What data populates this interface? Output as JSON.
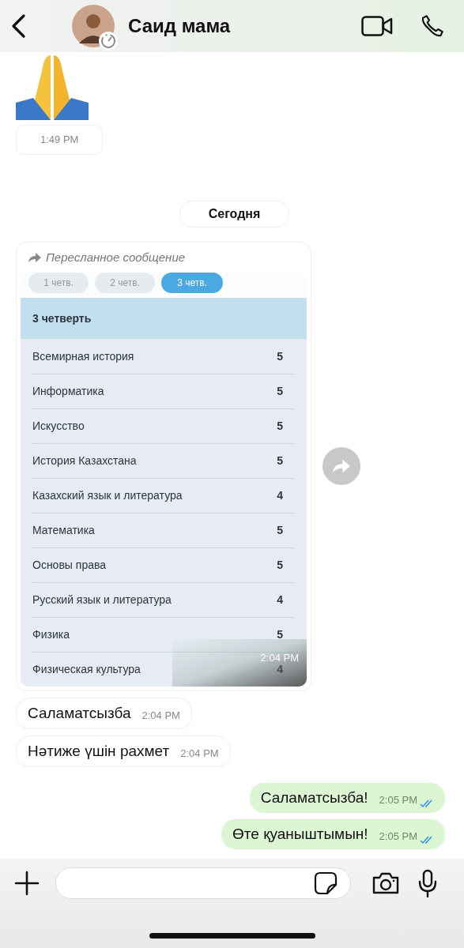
{
  "header": {
    "title": "Саид мама"
  },
  "messages": [
    {
      "kind": "sticker",
      "time": "1:49 PM"
    },
    {
      "kind": "date",
      "text": "Сегодня"
    },
    {
      "kind": "forwarded",
      "forward_label": "Пересланное сообщение",
      "time": "2:04 PM",
      "tabs": [
        {
          "label": "1 четв.",
          "selected": false
        },
        {
          "label": "2 четв.",
          "selected": false
        },
        {
          "label": "3 четв.",
          "selected": true
        }
      ],
      "table_title": "3 четверть",
      "rows": [
        {
          "subject": "Всемирная история",
          "grade": "5"
        },
        {
          "subject": "Информатика",
          "grade": "5"
        },
        {
          "subject": "Искусство",
          "grade": "5"
        },
        {
          "subject": "История Казахстана",
          "grade": "5"
        },
        {
          "subject": "Казахский язык и литература",
          "grade": "4"
        },
        {
          "subject": "Математика",
          "grade": "5"
        },
        {
          "subject": "Основы права",
          "grade": "5"
        },
        {
          "subject": "Русский язык и литература",
          "grade": "4"
        },
        {
          "subject": "Физика",
          "grade": "5"
        },
        {
          "subject": "Физическая культура",
          "grade": "4"
        }
      ]
    },
    {
      "kind": "text",
      "outgoing": false,
      "text": "Саламатсызба",
      "time": "2:04 PM"
    },
    {
      "kind": "text",
      "outgoing": false,
      "text": "Нәтиже үшін рахмет",
      "time": "2:04 PM"
    },
    {
      "kind": "text",
      "outgoing": true,
      "text": "Саламатсызба!",
      "time": "2:05 PM",
      "read": true
    },
    {
      "kind": "text",
      "outgoing": true,
      "text": "Өте қуаныштымын!",
      "time": "2:05 PM",
      "read": true
    }
  ]
}
